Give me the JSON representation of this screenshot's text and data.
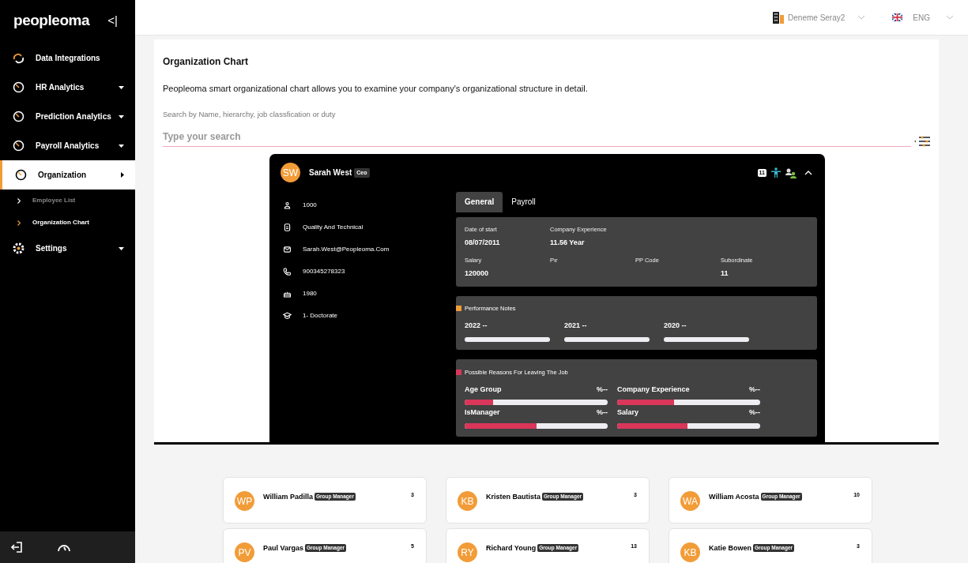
{
  "sidebar": {
    "logo": "peopleoma",
    "collapse": "<|",
    "items": [
      {
        "label": "Data Integrations",
        "kind": "integration",
        "selected": false
      },
      {
        "label": "HR Analytics",
        "kind": "analytics",
        "selected": false
      },
      {
        "label": "Prediction Analytics",
        "kind": "analytics",
        "selected": false
      },
      {
        "label": "Payroll Analytics",
        "kind": "analytics",
        "selected": false
      },
      {
        "label": "Organization",
        "kind": "analytics",
        "selected": true,
        "children": [
          {
            "label": "Employee List",
            "selected": false
          },
          {
            "label": "Organization Chart",
            "selected": true
          }
        ]
      },
      {
        "label": "Settings",
        "kind": "settings",
        "selected": false
      }
    ]
  },
  "header": {
    "company": "Deneme Seray2",
    "language": "ENG"
  },
  "page": {
    "title": "Organization Chart",
    "description": "Peopleoma smart organizational chart allows you to examine your company's organizational structure in detail.",
    "search_label": "Search by Name, hierarchy, job classfication or duty",
    "search_placeholder": "Type your search"
  },
  "root": {
    "initials": "SW",
    "name": "Sarah West",
    "badge": "Ceo",
    "count": "11",
    "expanded": true,
    "details": [
      {
        "kind": "person",
        "text": "1000"
      },
      {
        "kind": "department",
        "text": "Quality And Technical"
      },
      {
        "kind": "mail",
        "text": "Sarah.West@Peopleoma.Com"
      },
      {
        "kind": "phone",
        "text": "900345278323"
      },
      {
        "kind": "birth",
        "text": "1980"
      },
      {
        "kind": "education",
        "text": "1- Doctorate"
      }
    ],
    "tabs": [
      {
        "label": "General",
        "selected": true
      },
      {
        "label": "Payroll",
        "selected": false
      }
    ],
    "general": [
      [
        {
          "label": "Date of start",
          "value": "08/07/2011"
        },
        {
          "label": "Company Experience",
          "value": "11.56 Year"
        }
      ],
      [
        {
          "label": "Salary",
          "value": "120000"
        },
        {
          "label": "Pır"
        },
        {
          "label": "PP Code"
        },
        {
          "label": "Subordinate",
          "value": "11"
        }
      ]
    ],
    "performance": {
      "title": "Performance Notes",
      "color": "#f29c38",
      "years": [
        "2022 --",
        "2021 --",
        "2020 --"
      ]
    },
    "reasons": {
      "title": "Possible Reasons For Leaving The Job",
      "color": "#d9365a",
      "items": [
        {
          "label": "Age Group",
          "value": "%--",
          "level": 0.2
        },
        {
          "label": "Company Experience",
          "value": "%--",
          "level": 0.4
        },
        {
          "label": "IsManager",
          "value": "%--",
          "level": 0.5
        },
        {
          "label": "Salary",
          "value": "%--",
          "level": 0.49
        }
      ]
    }
  },
  "employees": [
    {
      "initials": "WP",
      "name": "William Padilla",
      "badge": "Group Manager",
      "count": "3"
    },
    {
      "initials": "KB",
      "name": "Kristen Bautista",
      "badge": "Group Manager",
      "count": "3"
    },
    {
      "initials": "WA",
      "name": "William Acosta",
      "badge": "Group Manager",
      "count": "10"
    },
    {
      "initials": "PV",
      "name": "Paul Vargas",
      "badge": "Group Manager",
      "count": "5"
    },
    {
      "initials": "RY",
      "name": "Richard Young",
      "badge": "Group Manager",
      "count": "13"
    },
    {
      "initials": "KB",
      "name": "Katie Bowen",
      "badge": "Group Manager",
      "count": "3"
    }
  ]
}
